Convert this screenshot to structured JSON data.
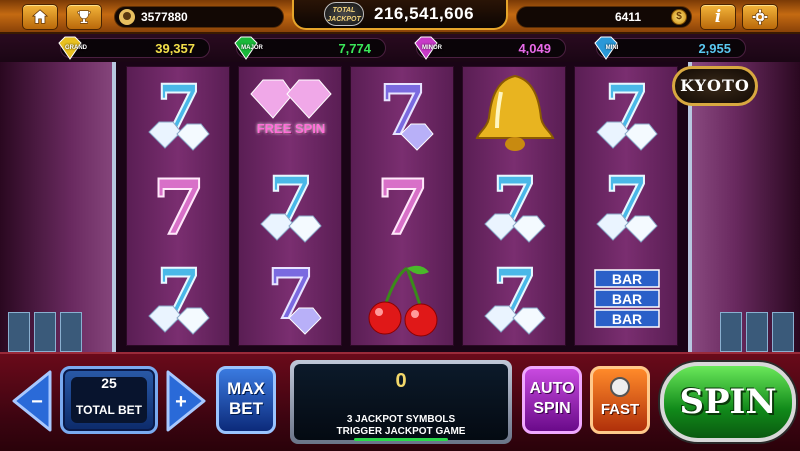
{
  "topbar": {
    "user_coins": "3577880",
    "jackpot_logo_line1": "TOTAL",
    "jackpot_logo_line2": "JACKPOT",
    "total_jackpot": "216,541,606",
    "balance": "6411",
    "coin_symbol": "$",
    "info_symbol": "i"
  },
  "tiers": [
    {
      "label": "GRAND",
      "value": "39,357",
      "color": "#f3e04a",
      "gem_color": "#e8c020"
    },
    {
      "label": "MAJOR",
      "value": "7,774",
      "color": "#3ae85a",
      "gem_color": "#1ab83a"
    },
    {
      "label": "MINOR",
      "value": "4,049",
      "color": "#e86ae8",
      "gem_color": "#c83ac8"
    },
    {
      "label": "MINI",
      "value": "2,955",
      "color": "#5ac8f0",
      "gem_color": "#2a98d8"
    }
  ],
  "reels": {
    "grid": [
      [
        "blue-seven-diamonds",
        "free-spin-diamonds",
        "purple-seven-diamonds",
        "golden-bell",
        "blue-seven-diamonds"
      ],
      [
        "pink-seven",
        "blue-seven-diamonds",
        "pink-seven",
        "blue-seven-diamonds",
        "blue-seven-diamonds"
      ],
      [
        "blue-seven-diamonds",
        "purple-seven-diamonds",
        "cherry",
        "blue-seven-diamonds",
        "triple-bar"
      ]
    ],
    "free_spin_text": "FREE SPIN",
    "bar_text": "BAR",
    "seven_text": "7"
  },
  "theme_badge": "KYOTO",
  "controls": {
    "minus_symbol": "−",
    "plus_symbol": "+",
    "total_bet_value": "25",
    "total_bet_label": "TOTAL BET",
    "max_bet_line1": "MAX",
    "max_bet_line2": "BET",
    "win_value": "0",
    "win_message_line1": "3 JACKPOT SYMBOLS",
    "win_message_line2": "TRIGGER JACKPOT GAME",
    "auto_spin_line1": "AUTO",
    "auto_spin_line2": "SPIN",
    "fast_label": "FAST",
    "spin_label": "SPIN"
  }
}
